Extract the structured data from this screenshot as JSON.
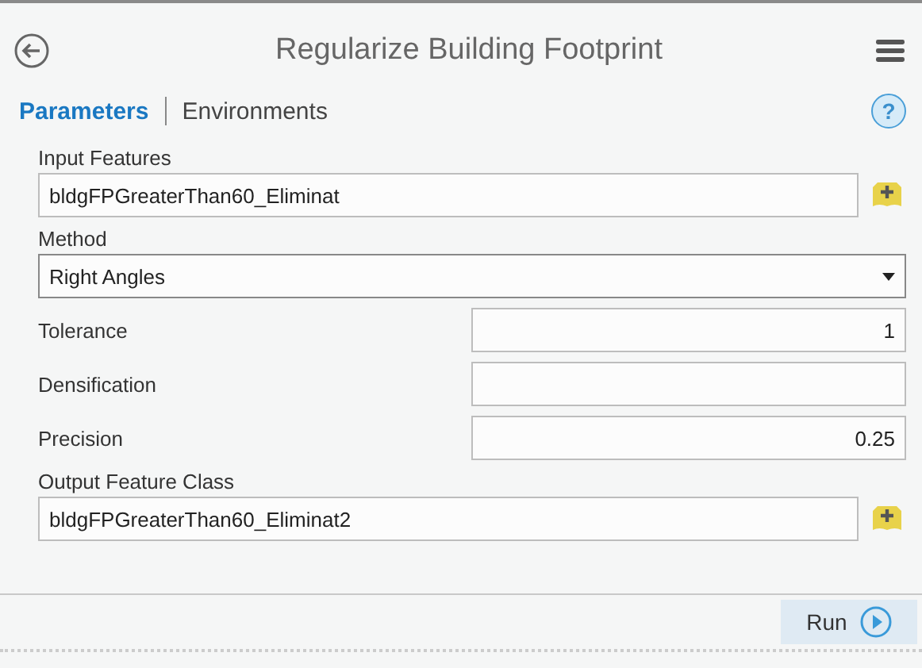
{
  "window": {
    "title": "Regularize Building Footprint"
  },
  "tabs": [
    {
      "label": "Parameters",
      "selected": true
    },
    {
      "label": "Environments",
      "selected": false
    }
  ],
  "parameters": [
    {
      "kind": "dataset",
      "label": "Input Features",
      "value": "bldgFPGreaterThan60_Eliminat"
    },
    {
      "kind": "dropdown",
      "label": "Method",
      "value": "Right Angles"
    },
    {
      "kind": "number",
      "label": "Tolerance",
      "value": "1"
    },
    {
      "kind": "number",
      "label": "Densification"
    },
    {
      "kind": "number",
      "label": "Precision",
      "value": "0.25"
    },
    {
      "kind": "dataset",
      "label": "Output Feature Class",
      "value": "bldgFPGreaterThan60_Eliminat2"
    }
  ],
  "help_button": {
    "label": "?"
  },
  "run_button": {
    "label": "Run"
  }
}
